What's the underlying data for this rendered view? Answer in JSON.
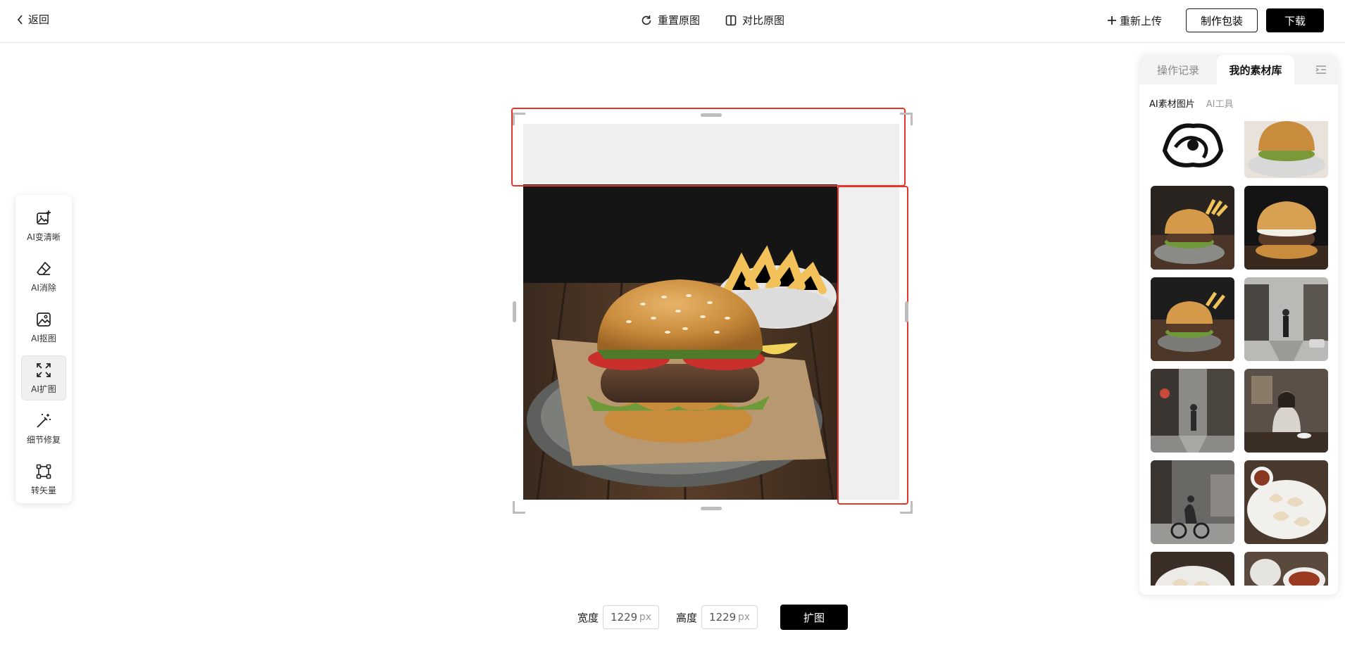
{
  "header": {
    "back_label": "返回",
    "reset_label": "重置原图",
    "compare_label": "对比原图",
    "reupload_label": "重新上传",
    "make_package_label": "制作包装",
    "download_label": "下载"
  },
  "toolbar": {
    "items": [
      {
        "label": "AI变清晰",
        "icon": "image-sparkle-icon"
      },
      {
        "label": "AI消除",
        "icon": "eraser-icon"
      },
      {
        "label": "AI抠图",
        "icon": "image-cutout-icon"
      },
      {
        "label": "AI扩图",
        "icon": "expand-icon",
        "active": true
      },
      {
        "label": "细节修复",
        "icon": "magic-wand-icon"
      },
      {
        "label": "转矢量",
        "icon": "vector-square-icon"
      }
    ]
  },
  "controls": {
    "width_label": "宽度",
    "width_value": "1229",
    "height_label": "高度",
    "height_value": "1229",
    "unit": "px",
    "expand_label": "扩图"
  },
  "panel": {
    "tabs": [
      {
        "label": "操作记录",
        "active": false
      },
      {
        "label": "我的素材库",
        "active": true
      }
    ],
    "collapse_icon": "collapse-panel-icon",
    "subtabs": [
      {
        "label": "AI素材图片",
        "active": true
      },
      {
        "label": "AI工具",
        "active": false
      }
    ],
    "thumbnails": [
      "dragon-emblem",
      "burger-plate",
      "burger-fries",
      "burger-dark",
      "burger-board",
      "street-man",
      "street-walker",
      "woman-cafe",
      "cyclist-street",
      "dumplings-tea",
      "dumplings-bowl",
      "soup-dumplings"
    ]
  },
  "colors": {
    "accent_red": "#e8352b",
    "button_dark": "#000000",
    "fill_gray": "#efefef"
  }
}
